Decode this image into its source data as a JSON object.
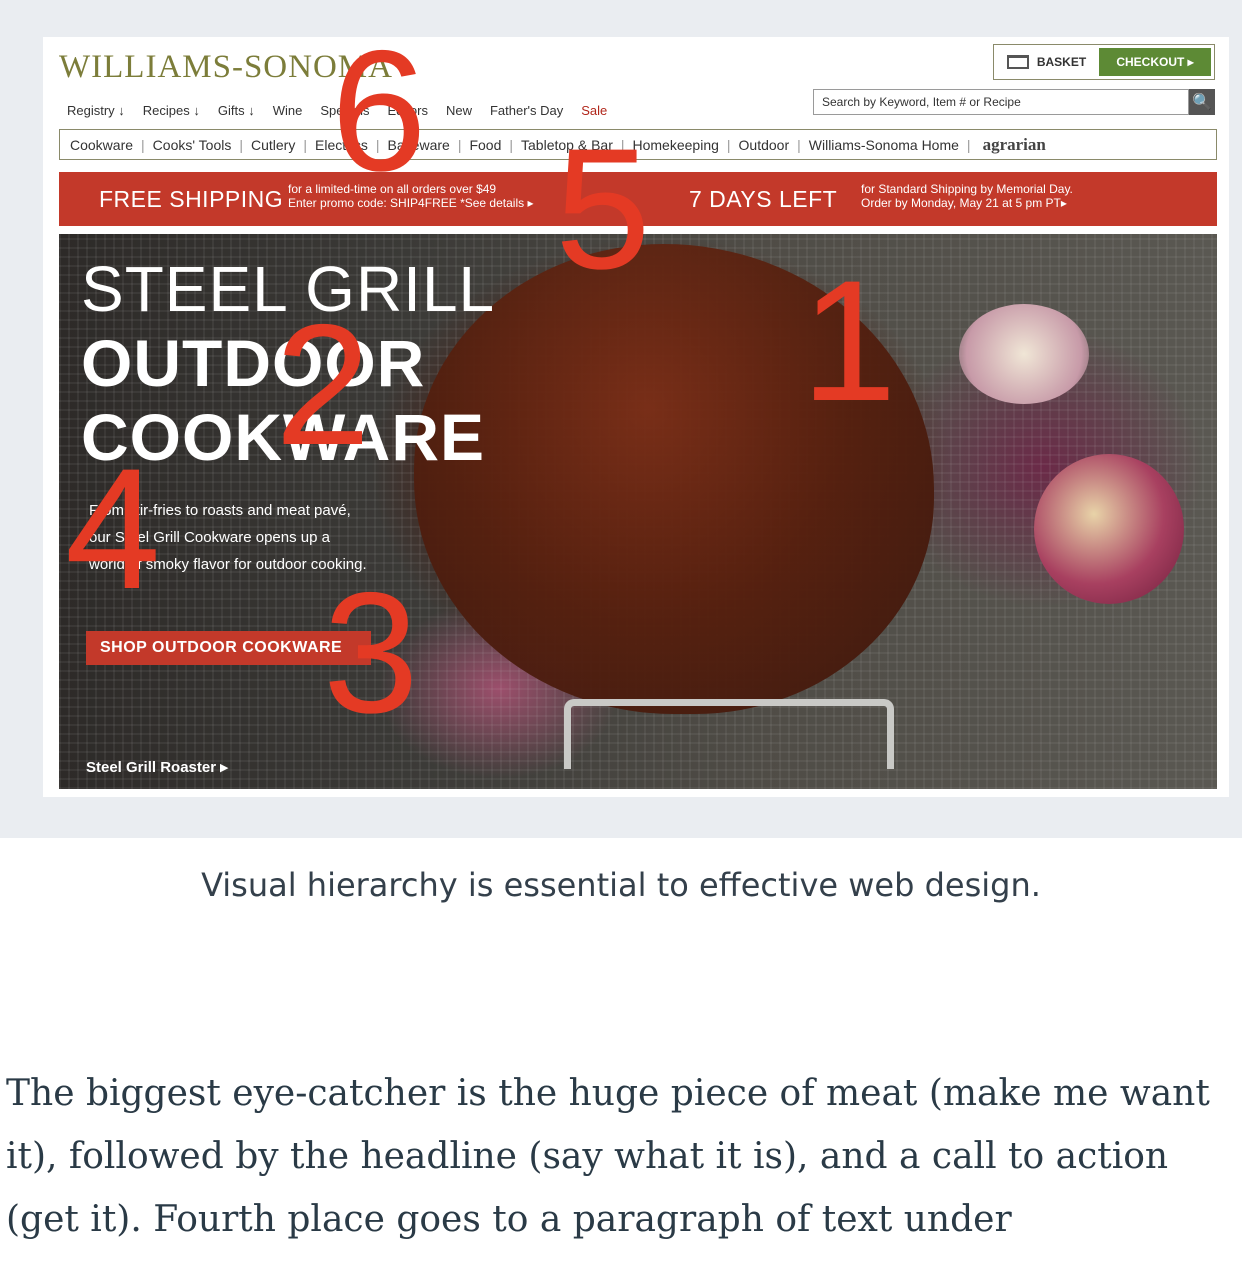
{
  "site": {
    "logo": "WILLIAMS-SONOMA",
    "basket_label": "BASKET",
    "checkout_label": "CHECKOUT ▸",
    "search_placeholder": "Search by Keyword, Item # or Recipe",
    "top_links": [
      "Registry ↓",
      "Recipes ↓",
      "Gifts ↓",
      "Wine",
      "Specials",
      "Editors",
      "New",
      "Father's Day",
      "Sale"
    ],
    "categories": [
      "Cookware",
      "Cooks' Tools",
      "Cutlery",
      "Electrics",
      "Bakeware",
      "Food",
      "Tabletop & Bar",
      "Homekeeping",
      "Outdoor",
      "Williams-Sonoma Home"
    ],
    "partner_brand": "agrarian"
  },
  "promo": {
    "free_shipping": "FREE SHIPPING",
    "free_note_1": "for a limited-time on all orders over $49",
    "free_note_2": "Enter promo code: SHIP4FREE  *See details ▸",
    "days_left": "7 DAYS LEFT",
    "days_note_1": "for Standard Shipping by Memorial Day.",
    "days_note_2": "Order by Monday, May 21 at 5 pm PT▸"
  },
  "hero": {
    "title_line1": "STEEL GRILL",
    "title_line2": "OUTDOOR",
    "title_line3": "COOKWARE",
    "body": "From stir-fries to roasts and meat pavé, our Steel Grill Cookware opens up a world of smoky flavor for outdoor cooking.",
    "cta_label": "SHOP OUTDOOR COOKWARE",
    "product_link": "Steel Grill Roaster ▸"
  },
  "overlay_numbers": [
    "1",
    "2",
    "3",
    "4",
    "5",
    "6"
  ],
  "caption": "Visual hierarchy is essential to effective web design.",
  "article_text": "The biggest eye-catcher is the huge piece of meat (make me want it), followed by the headline (say what it is), and a call to action (get it). Fourth place goes to a paragraph of text under"
}
